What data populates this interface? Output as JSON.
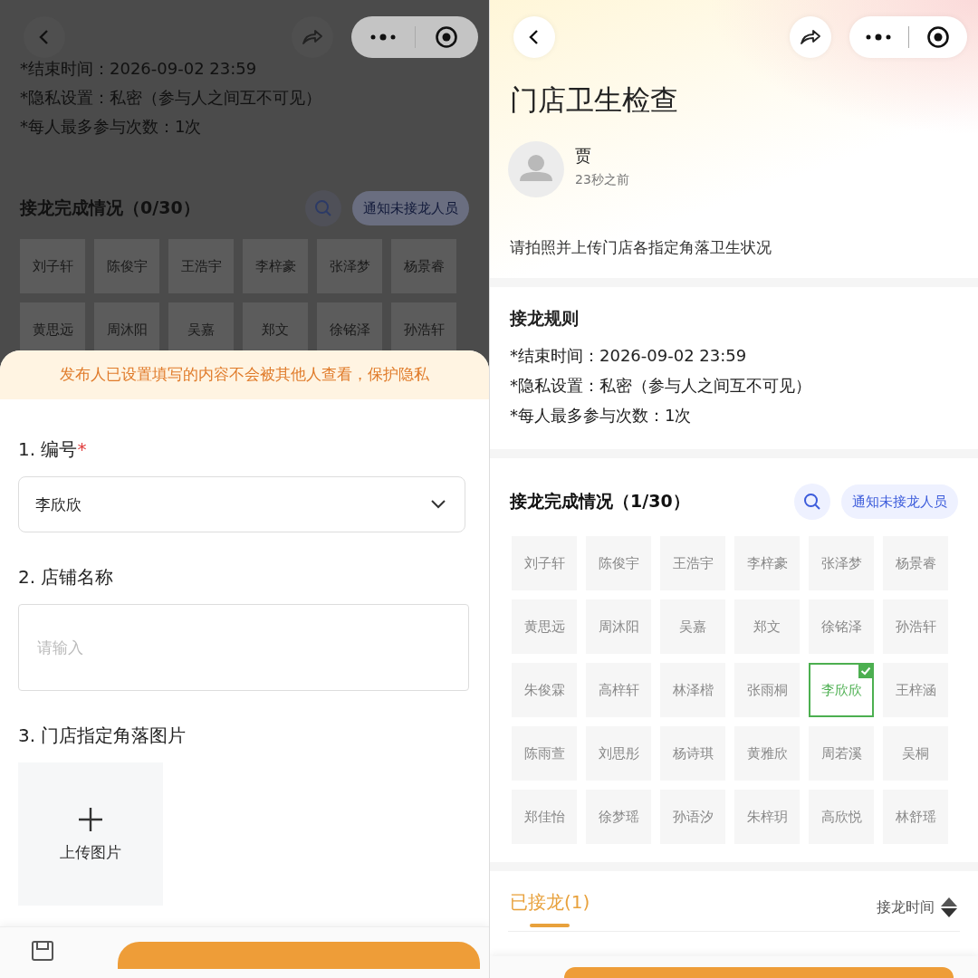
{
  "left_screen": {
    "rules": [
      "*结束时间：2026-09-02 23:59",
      "*隐私设置：私密（参与人之间互不可见）",
      "*每人最多参与次数：1次"
    ],
    "status": {
      "title": "接龙完成情况（0/30）",
      "notify_button": "通知未接龙人员"
    },
    "members": [
      {
        "name": "刘子轩",
        "checked": false
      },
      {
        "name": "陈俊宇",
        "checked": false
      },
      {
        "name": "王浩宇",
        "checked": false
      },
      {
        "name": "李梓豪",
        "checked": false
      },
      {
        "name": "张泽梦",
        "checked": false
      },
      {
        "name": "杨景睿",
        "checked": false
      },
      {
        "name": "黄思远",
        "checked": false
      },
      {
        "name": "周沐阳",
        "checked": false
      },
      {
        "name": "吴嘉",
        "checked": false
      },
      {
        "name": "郑文",
        "checked": false
      },
      {
        "name": "徐铭泽",
        "checked": false
      },
      {
        "name": "孙浩轩",
        "checked": false
      }
    ],
    "sheet": {
      "notice": "发布人已设置填写的内容不会被其他人查看，保护隐私",
      "questions": [
        {
          "kind": "select",
          "label": "1. 编号",
          "required_mark": "*",
          "value": "李欣欣"
        },
        {
          "kind": "text",
          "label": "2. 店铺名称",
          "placeholder": "请输入"
        },
        {
          "kind": "upload",
          "label": "3. 门店指定角落图片",
          "upload_label": "上传图片"
        }
      ]
    }
  },
  "right_screen": {
    "title": "门店卫生检查",
    "author": {
      "name": "贾",
      "time": "23秒之前"
    },
    "description": "请拍照并上传门店各指定角落卫生状况",
    "rules": {
      "heading": "接龙规则",
      "items": [
        "*结束时间：2026-09-02 23:59",
        "*隐私设置：私密（参与人之间互不可见）",
        "*每人最多参与次数：1次"
      ]
    },
    "status": {
      "title": "接龙完成情况（1/30）",
      "notify_button": "通知未接龙人员"
    },
    "members": [
      {
        "name": "刘子轩",
        "checked": false
      },
      {
        "name": "陈俊宇",
        "checked": false
      },
      {
        "name": "王浩宇",
        "checked": false
      },
      {
        "name": "李梓豪",
        "checked": false
      },
      {
        "name": "张泽梦",
        "checked": false
      },
      {
        "name": "杨景睿",
        "checked": false
      },
      {
        "name": "黄思远",
        "checked": false
      },
      {
        "name": "周沐阳",
        "checked": false
      },
      {
        "name": "吴嘉",
        "checked": false
      },
      {
        "name": "郑文",
        "checked": false
      },
      {
        "name": "徐铭泽",
        "checked": false
      },
      {
        "name": "孙浩轩",
        "checked": false
      },
      {
        "name": "朱俊霖",
        "checked": false
      },
      {
        "name": "高梓轩",
        "checked": false
      },
      {
        "name": "林泽楷",
        "checked": false
      },
      {
        "name": "张雨桐",
        "checked": false
      },
      {
        "name": "李欣欣",
        "checked": true
      },
      {
        "name": "王梓涵",
        "checked": false
      },
      {
        "name": "陈雨萱",
        "checked": false
      },
      {
        "name": "刘思彤",
        "checked": false
      },
      {
        "name": "杨诗琪",
        "checked": false
      },
      {
        "name": "黄雅欣",
        "checked": false
      },
      {
        "name": "周若溪",
        "checked": false
      },
      {
        "name": "吴桐",
        "checked": false
      },
      {
        "name": "郑佳怡",
        "checked": false
      },
      {
        "name": "徐梦瑶",
        "checked": false
      },
      {
        "name": "孙语汐",
        "checked": false
      },
      {
        "name": "朱梓玥",
        "checked": false
      },
      {
        "name": "高欣悦",
        "checked": false
      },
      {
        "name": "林舒瑶",
        "checked": false
      }
    ],
    "tabs": [
      {
        "label": "已接龙(1)",
        "selected": true
      }
    ],
    "sort_label": "接龙时间"
  }
}
